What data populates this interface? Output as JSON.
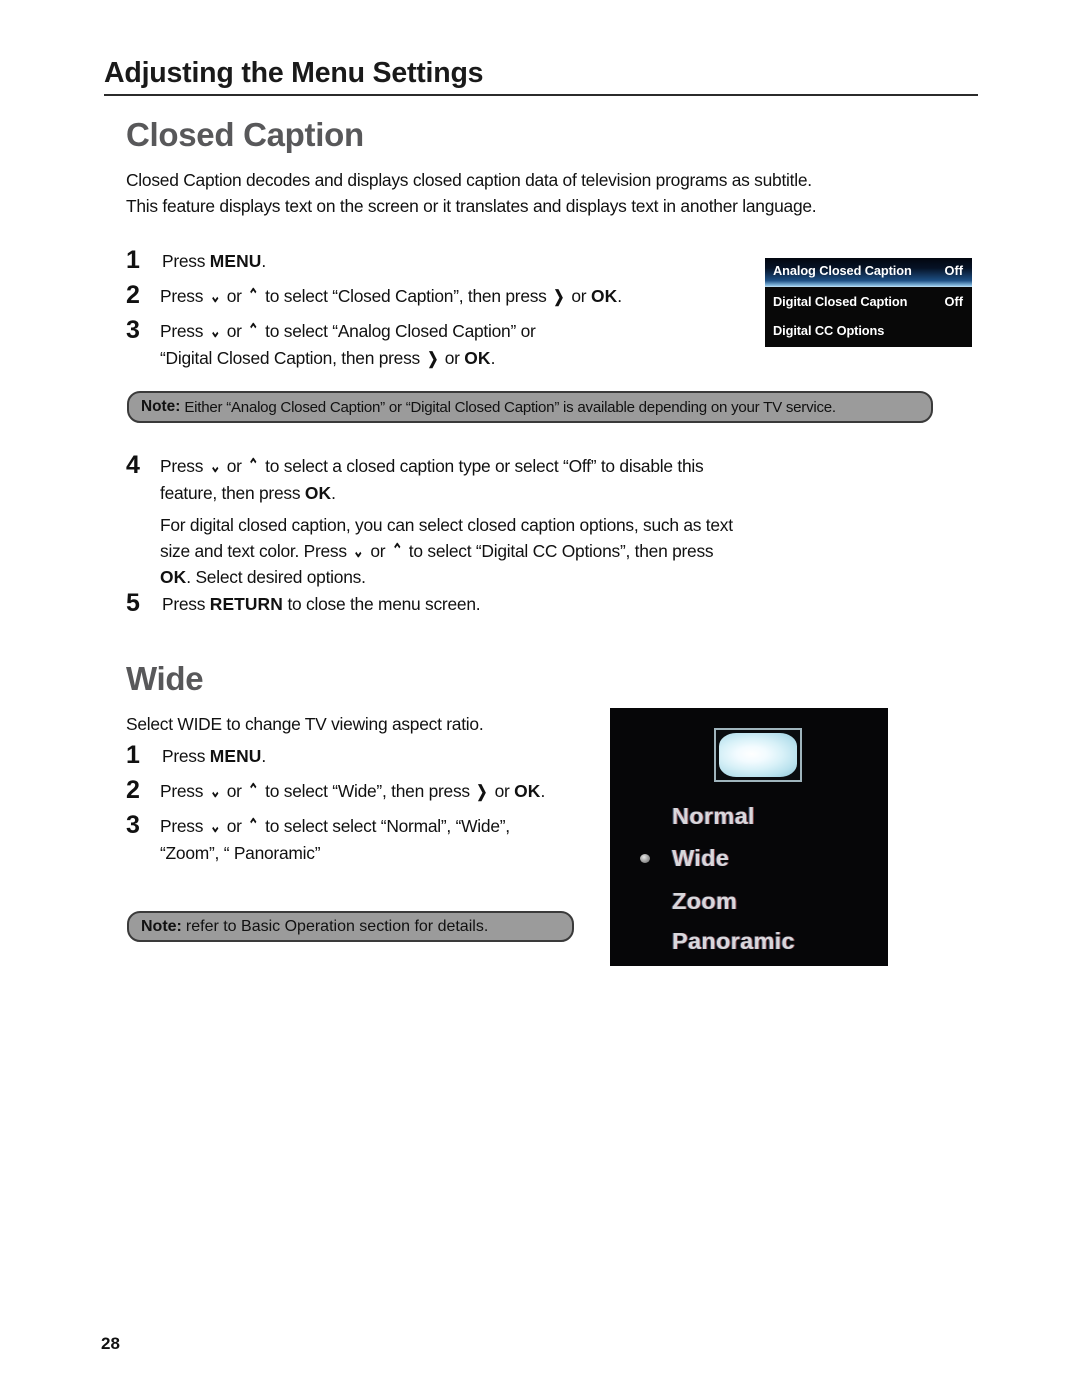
{
  "page": {
    "running_header": "Adjusting the Menu Settings",
    "page_number": "28"
  },
  "closed_caption": {
    "heading": "Closed Caption",
    "intro": "Closed Caption decodes and displays closed caption data of television programs as subtitle. This feature displays text on the screen or it translates and displays text in another language.",
    "steps_top": [
      {
        "num": "1",
        "text": "Press MENU."
      },
      {
        "num": "2",
        "text": "Press ⌄ or ⌃ to select “Closed Caption”, then press ❯ or OK."
      },
      {
        "num": "3",
        "text": "Press ⌄ or ⌃ to select “Analog Closed Caption” or “Digital Closed Caption, then press ❯ or OK."
      }
    ],
    "step4": {
      "num": "4",
      "text": "Press ⌄ or ⌃ to select a closed caption type or select “Off” to disable this feature, then press OK.",
      "sub_text": "For digital closed caption, you can select closed caption options, such as text size and text color. Press ⌄ or ⌃ to select “Digital CC Options”, then press OK. Select desired options."
    },
    "step5": {
      "num": "5",
      "text": "Press RETURN to close the menu screen."
    },
    "note": {
      "label": "Note:",
      "text": "Either “Analog Closed Caption” or “Digital Closed Caption” is available depending on your TV service."
    },
    "tv_menu": {
      "rows": [
        {
          "label": "Analog Closed Caption",
          "value": "Off",
          "selected": true
        },
        {
          "label": "Digital Closed Caption",
          "value": "Off",
          "selected": false
        },
        {
          "label": "Digital CC Options",
          "value": "",
          "selected": false
        }
      ],
      "highlight_color": "#1d4f84",
      "background_color": "#080808"
    }
  },
  "wide": {
    "heading": "Wide",
    "intro": "Select WIDE to change TV viewing aspect ratio.",
    "steps": [
      {
        "num": "1",
        "text": "Press MENU."
      },
      {
        "num": "2",
        "text": "Press ⌄ or ⌃ to select “Wide”, then press ❯ or OK."
      },
      {
        "num": "3",
        "text": "Press ⌄ or ⌃ to select select “Normal”, “Wide”, “Zoom”, “ Panoramic”"
      }
    ],
    "note": {
      "label": "Note:",
      "text": "refer to Basic Operation section for details."
    },
    "tv_menu": {
      "options": [
        "Normal",
        "Wide",
        "Zoom",
        "Panoramic"
      ],
      "selected": "Wide",
      "background_color": "#060608",
      "text_color": "#d8d8dc"
    }
  },
  "parts": {
    "press": "Press ",
    "or": " or ",
    "menu": "MENU",
    "ok": "OK",
    "return": "RETURN",
    "period": ".",
    "chev_down": "⌄",
    "chev_up": "⌃",
    "chev_right": "❯",
    "s2_mid": " to select “Closed Caption”, then press ",
    "s2_tail": " or ",
    "s3_mid": " to select “Analog Closed Caption” or",
    "s3_line2a": "“Digital Closed Caption, then press ",
    "s4_mid": " to select a closed caption type or select “Off” to disable this",
    "s4_line2": "feature, then press ",
    "s4p_line1": "For digital closed caption, you can select closed caption options, such as text",
    "s4p_line2a": "size and text color. Press ",
    "s4p_line2b": " to select “Digital CC Options”, then press",
    "s4p_line3": ". Select desired options.",
    "s5_tail": " to close the menu screen.",
    "w2_mid": " to select “Wide”, then press ",
    "w3_mid": " to select select “Normal”, “Wide”,",
    "w3_line2": "“Zoom”, “ Panoramic”"
  }
}
